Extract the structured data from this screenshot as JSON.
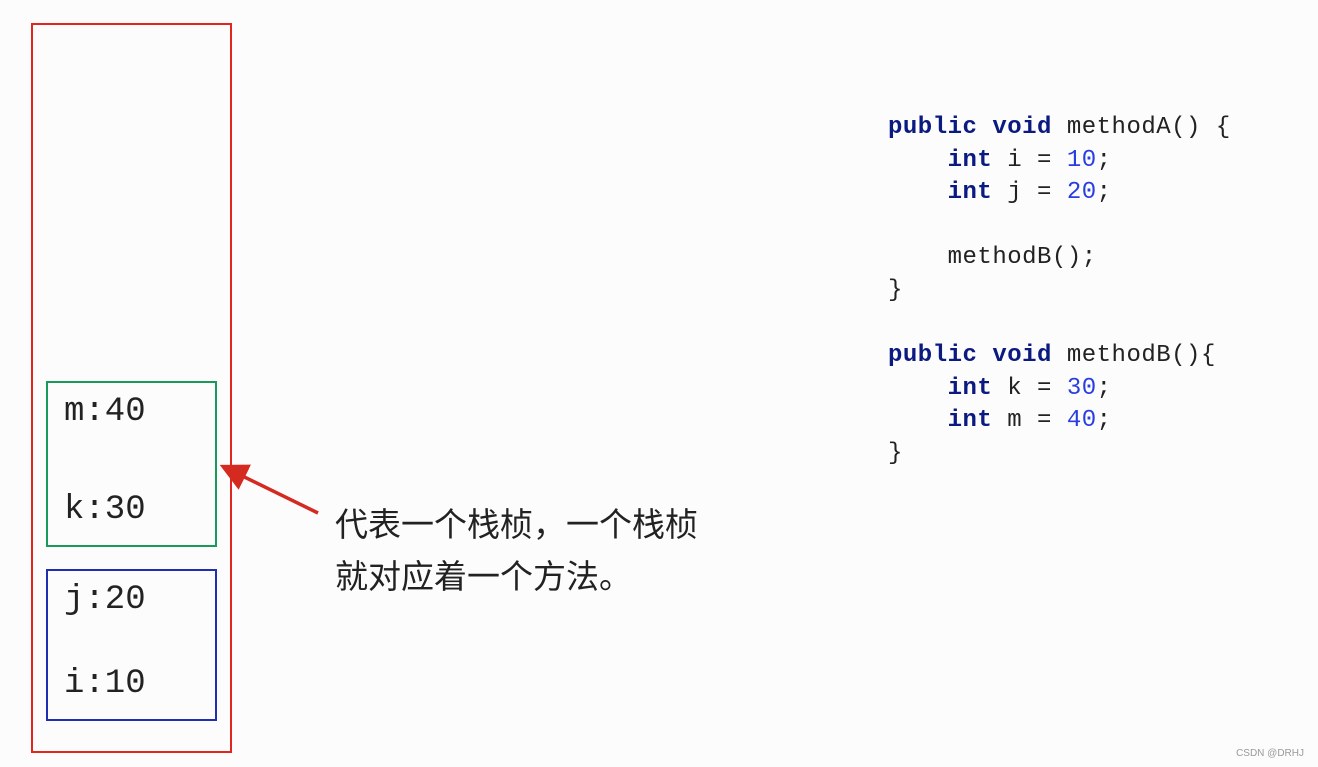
{
  "stack": {
    "frames": [
      {
        "method": "methodB",
        "vars": [
          "m:40",
          "k:30"
        ],
        "color": "#1a9a5a"
      },
      {
        "method": "methodA",
        "vars": [
          "j:20",
          "i:10"
        ],
        "color": "#1f2fb0"
      }
    ],
    "border_color": "#e0261f"
  },
  "annotation": {
    "line1": "代表一个栈桢，一个栈桢",
    "line2": "就对应着一个方法。",
    "arrow_color": "#d42a20"
  },
  "code": {
    "lines": [
      [
        {
          "t": "public void",
          "c": "kw"
        },
        {
          "t": " methodA() {"
        }
      ],
      [
        {
          "t": "    "
        },
        {
          "t": "int",
          "c": "kw"
        },
        {
          "t": " i = "
        },
        {
          "t": "10",
          "c": "num"
        },
        {
          "t": ";"
        }
      ],
      [
        {
          "t": "    "
        },
        {
          "t": "int",
          "c": "kw"
        },
        {
          "t": " j = "
        },
        {
          "t": "20",
          "c": "num"
        },
        {
          "t": ";"
        }
      ],
      [
        {
          "t": ""
        }
      ],
      [
        {
          "t": "    methodB();"
        }
      ],
      [
        {
          "t": "}"
        }
      ],
      [
        {
          "t": ""
        }
      ],
      [
        {
          "t": "public void",
          "c": "kw"
        },
        {
          "t": " methodB(){"
        }
      ],
      [
        {
          "t": "    "
        },
        {
          "t": "int",
          "c": "kw"
        },
        {
          "t": " k = "
        },
        {
          "t": "30",
          "c": "num"
        },
        {
          "t": ";"
        }
      ],
      [
        {
          "t": "    "
        },
        {
          "t": "int",
          "c": "kw"
        },
        {
          "t": " m = "
        },
        {
          "t": "40",
          "c": "num"
        },
        {
          "t": ";"
        }
      ],
      [
        {
          "t": "}"
        }
      ]
    ]
  },
  "watermark": "CSDN @DRHJ"
}
